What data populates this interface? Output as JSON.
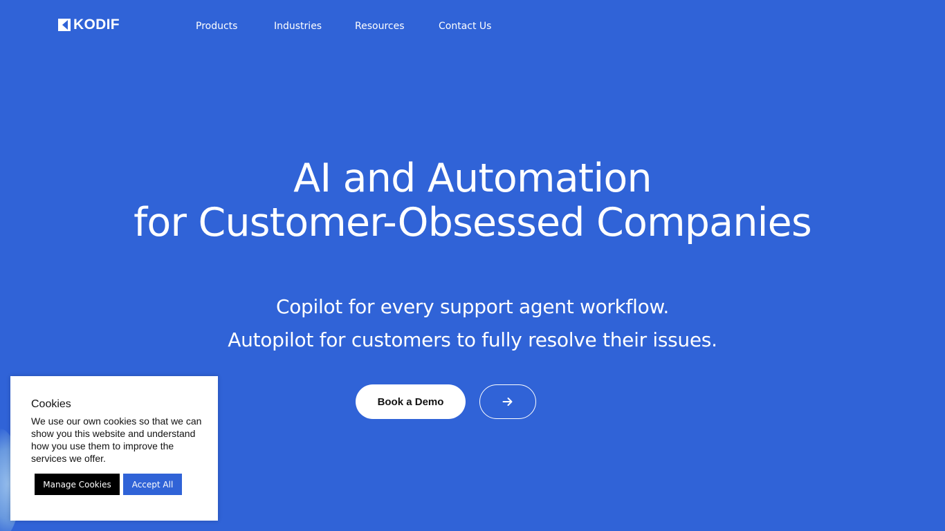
{
  "brand": {
    "logo_text": "KODIF",
    "logo_icon": "kodif-k-logo-icon"
  },
  "nav": {
    "items": [
      {
        "label": "Products"
      },
      {
        "label": "Industries"
      },
      {
        "label": "Resources"
      },
      {
        "label": "Contact Us"
      }
    ]
  },
  "hero": {
    "title_line1": "AI and Automation",
    "title_line2": "for Customer-Obsessed Companies",
    "subtitle_line1": "Copilot for every support agent workflow.",
    "subtitle_line2": "Autopilot for customers to fully resolve their issues.",
    "demo_button": "Book a Demo",
    "arrow_icon": "arrow-right-icon"
  },
  "cookie_banner": {
    "title": "Cookies",
    "text": "We use our own cookies so that we can show you this website and understand how you use them to improve the services we offer.",
    "manage_button": "Manage Cookies",
    "accept_button": "Accept All"
  },
  "colors": {
    "background": "#3063d7",
    "text": "#ffffff",
    "accept_button": "#3063d7",
    "manage_button": "#000000"
  }
}
